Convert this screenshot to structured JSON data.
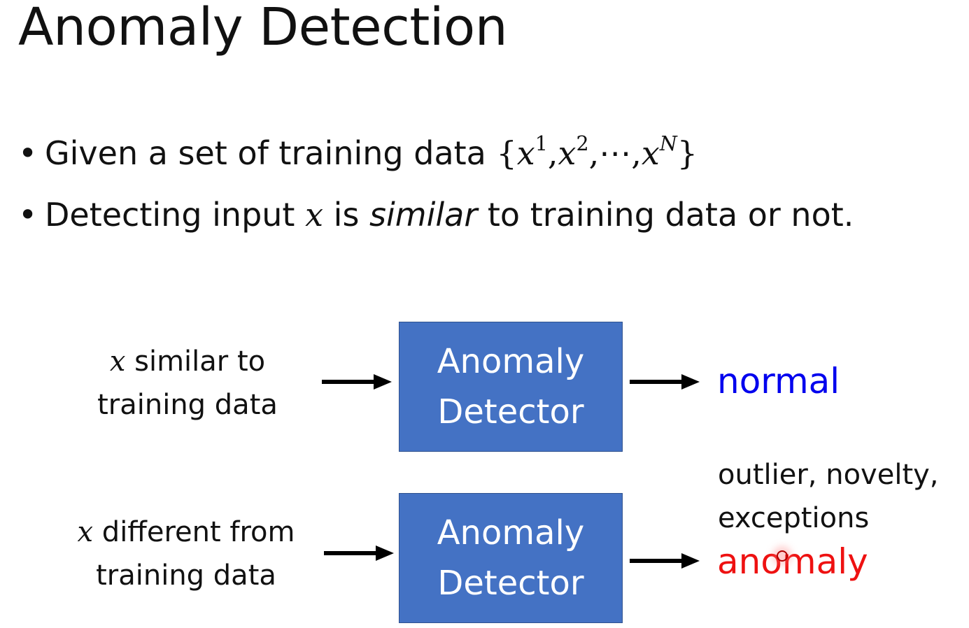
{
  "slide": {
    "title": "Anomaly Detection"
  },
  "bullets": {
    "b1_text": "Given a set of training data",
    "b1_set": {
      "open": "{",
      "var": "x",
      "sup1": "1",
      "sup2": "2",
      "ellipsis": "⋯",
      "supN": "N",
      "close": "}",
      "comma": ","
    },
    "b2_pre": "Detecting input",
    "b2_var": "x",
    "b2_is": "is",
    "b2_em": "similar",
    "b2_post": "to training data or not."
  },
  "diagram": {
    "top_input_var": "x",
    "top_input_line1": "similar to",
    "top_input_line2": "training data",
    "bottom_input_var": "x",
    "bottom_input_line1": "different from",
    "bottom_input_line2": "training data",
    "detector_line1": "Anomaly",
    "detector_line2": "Detector",
    "output_normal": "normal",
    "output_synonyms_line1": "outlier, novelty,",
    "output_synonyms_line2": "exceptions",
    "output_anomaly": "anomaly"
  },
  "colors": {
    "detector_fill": "#4472c4",
    "normal_text": "#0000ee",
    "anomaly_text": "#ee1111"
  }
}
